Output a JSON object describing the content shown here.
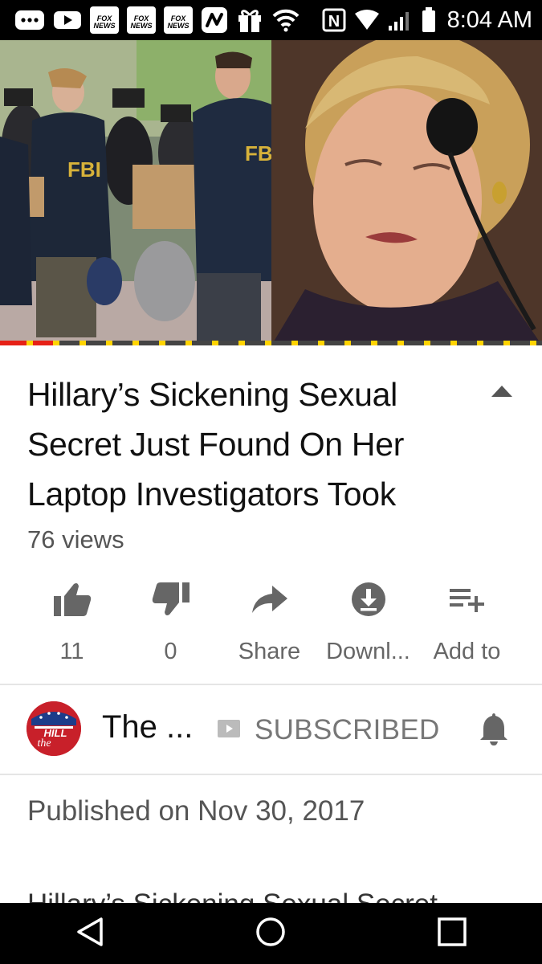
{
  "status_bar": {
    "time": "8:04 AM",
    "notif_fox_1": "FOX NEWS",
    "notif_fox_2": "FOX NEWS",
    "notif_fox_3": "FOX NEWS",
    "nfc": "N"
  },
  "video": {
    "progress_fraction": 0.1,
    "colors": {
      "progress": "#e62117",
      "ad_marker": "#ffd400"
    }
  },
  "video_info": {
    "title": "Hillary’s Sickening Sexual Secret Just Found On Her Laptop Investigators Took",
    "views": "76 views"
  },
  "actions": {
    "like_count": "11",
    "dislike_count": "0",
    "share_label": "Share",
    "download_label": "Downl...",
    "add_to_label": "Add to"
  },
  "channel": {
    "name": "The ...",
    "subscribe_state": "SUBSCRIBED",
    "avatar_text": "HILL"
  },
  "description": {
    "published": "Published on Nov 30, 2017",
    "cut_text": "Hillary’s Sickening Sexual Secret"
  }
}
